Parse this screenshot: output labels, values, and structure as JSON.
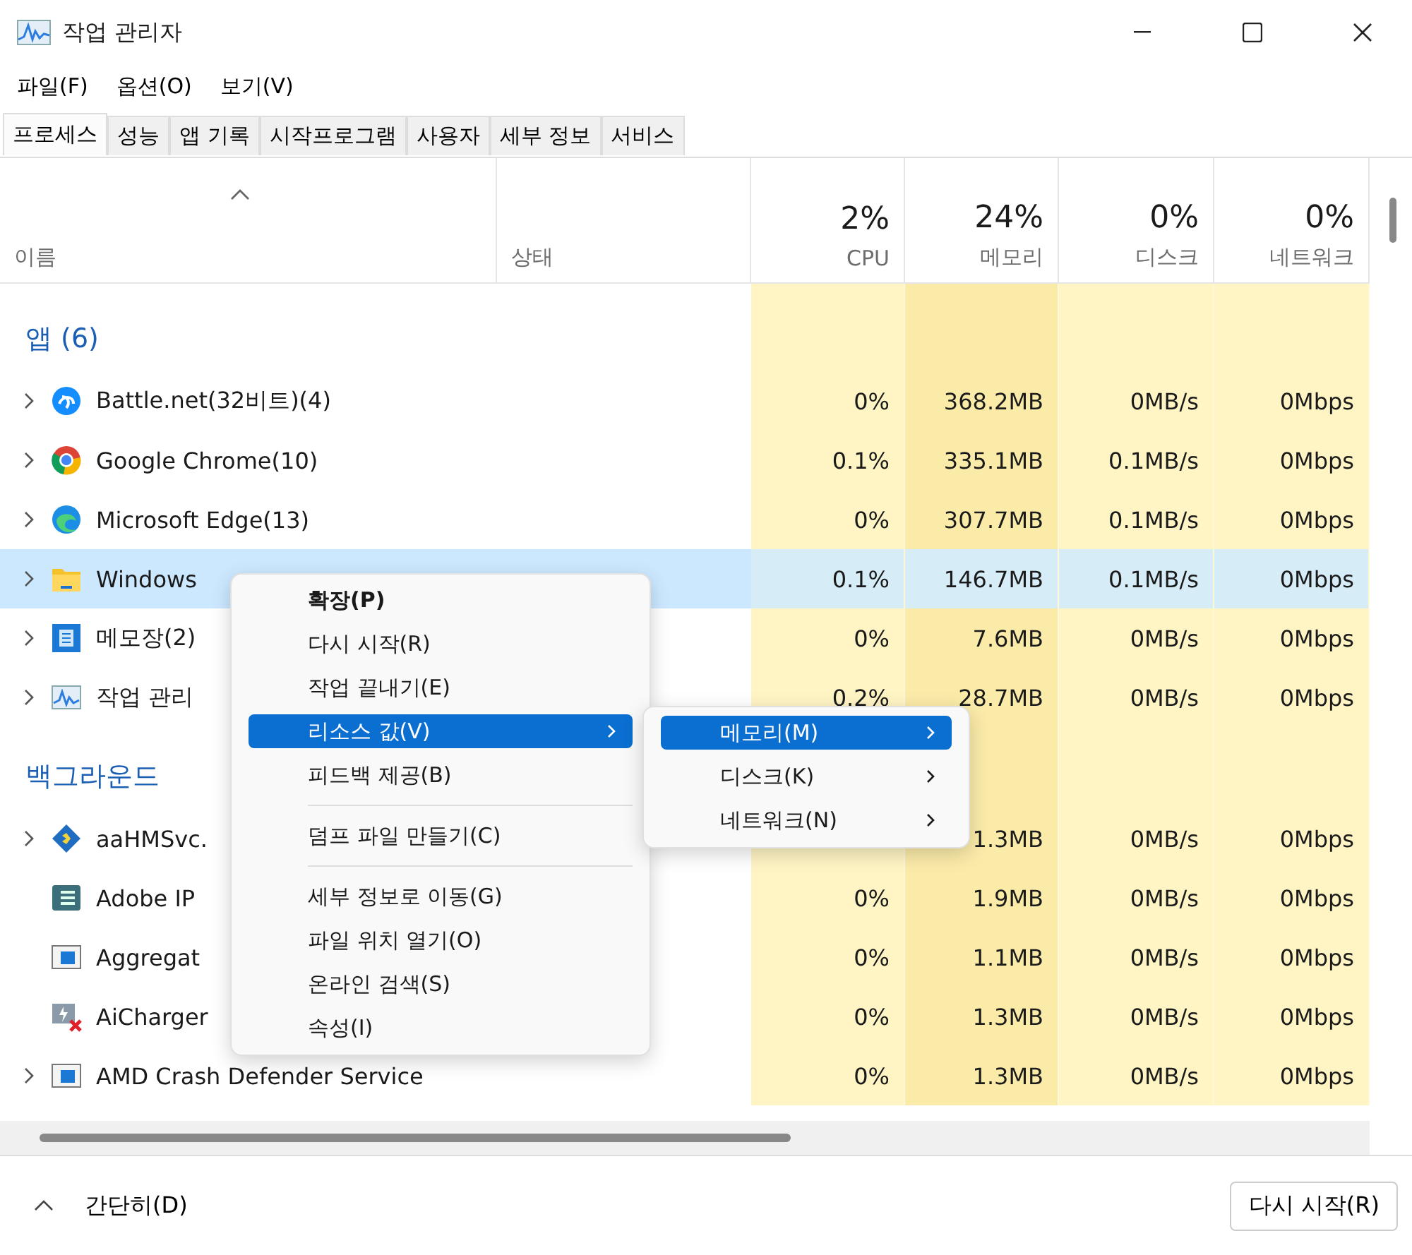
{
  "window": {
    "title": "작업 관리자"
  },
  "menu_bar": [
    "파일(F)",
    "옵션(O)",
    "보기(V)"
  ],
  "tabs": [
    {
      "label": "프로세스",
      "selected": true
    },
    {
      "label": "성능",
      "selected": false
    },
    {
      "label": "앱 기록",
      "selected": false
    },
    {
      "label": "시작프로그램",
      "selected": false
    },
    {
      "label": "사용자",
      "selected": false
    },
    {
      "label": "세부 정보",
      "selected": false
    },
    {
      "label": "서비스",
      "selected": false
    }
  ],
  "columns": [
    {
      "label": "이름",
      "sorted": true
    },
    {
      "label": "상태",
      "sorted": false
    },
    {
      "percent": "2%",
      "label": "CPU"
    },
    {
      "percent": "24%",
      "label": "메모리"
    },
    {
      "percent": "0%",
      "label": "디스크"
    },
    {
      "percent": "0%",
      "label": "네트워크"
    }
  ],
  "groups": [
    {
      "title": "앱 (6)",
      "rows": [
        {
          "name": "Battle.net(32비트)(4)",
          "kind": "swirl",
          "expandable": true,
          "selected": false,
          "cpu": "0%",
          "memory": "368.2MB",
          "disk": "0MB/s",
          "network": "0Mbps"
        },
        {
          "name": "Google Chrome(10)",
          "kind": "ring",
          "expandable": true,
          "selected": false,
          "cpu": "0.1%",
          "memory": "335.1MB",
          "disk": "0.1MB/s",
          "network": "0Mbps"
        },
        {
          "name": "Microsoft Edge(13)",
          "kind": "wave",
          "expandable": true,
          "selected": false,
          "cpu": "0%",
          "memory": "307.7MB",
          "disk": "0.1MB/s",
          "network": "0Mbps"
        },
        {
          "name": "Windows",
          "kind": "folder",
          "expandable": true,
          "selected": true,
          "cpu": "0.1%",
          "memory": "146.7MB",
          "disk": "0.1MB/s",
          "network": "0Mbps"
        },
        {
          "name": "메모장(2)",
          "kind": "notepad",
          "expandable": true,
          "selected": false,
          "cpu": "0%",
          "memory": "7.6MB",
          "disk": "0MB/s",
          "network": "0Mbps"
        },
        {
          "name": "작업 관리",
          "kind": "chart",
          "expandable": true,
          "selected": false,
          "cpu": "0.2%",
          "memory": "28.7MB",
          "disk": "0MB/s",
          "network": "0Mbps"
        }
      ]
    },
    {
      "title": "백그라운드",
      "rows": [
        {
          "name": "aaHMSvc.",
          "kind": "diamond",
          "expandable": true,
          "selected": false,
          "memory": "1.3MB",
          "disk": "0MB/s",
          "network": "0Mbps"
        },
        {
          "name": "Adobe IP",
          "kind": "stack",
          "expandable": false,
          "selected": false,
          "cpu": "0%",
          "memory": "1.9MB",
          "disk": "0MB/s",
          "network": "0Mbps"
        },
        {
          "name": "Aggregat",
          "kind": "window",
          "expandable": false,
          "selected": false,
          "cpu": "0%",
          "memory": "1.1MB",
          "disk": "0MB/s",
          "network": "0Mbps"
        },
        {
          "name": "AiCharger",
          "kind": "plug",
          "expandable": false,
          "selected": false,
          "cpu": "0%",
          "memory": "1.3MB",
          "disk": "0MB/s",
          "network": "0Mbps"
        },
        {
          "name": "AMD Crash Defender Service",
          "kind": "window",
          "expandable": true,
          "selected": false,
          "cpu": "0%",
          "memory": "1.3MB",
          "disk": "0MB/s",
          "network": "0Mbps"
        }
      ]
    }
  ],
  "context_menu": [
    {
      "kind": "item",
      "label": "확장(P)",
      "bold": true,
      "selected": false,
      "submenu": false
    },
    {
      "kind": "item",
      "label": "다시 시작(R)",
      "bold": false,
      "selected": false,
      "submenu": false
    },
    {
      "kind": "item",
      "label": "작업 끝내기(E)",
      "bold": false,
      "selected": false,
      "submenu": false
    },
    {
      "kind": "item",
      "label": "리소스 값(V)",
      "bold": false,
      "selected": true,
      "submenu": true
    },
    {
      "kind": "item",
      "label": "피드백 제공(B)",
      "bold": false,
      "selected": false,
      "submenu": false
    },
    {
      "kind": "separator"
    },
    {
      "kind": "item",
      "label": "덤프 파일 만들기(C)",
      "bold": false,
      "selected": false,
      "submenu": false
    },
    {
      "kind": "separator"
    },
    {
      "kind": "item",
      "label": "세부 정보로 이동(G)",
      "bold": false,
      "selected": false,
      "submenu": false
    },
    {
      "kind": "item",
      "label": "파일 위치 열기(O)",
      "bold": false,
      "selected": false,
      "submenu": false
    },
    {
      "kind": "item",
      "label": "온라인 검색(S)",
      "bold": false,
      "selected": false,
      "submenu": false
    },
    {
      "kind": "item",
      "label": "속성(I)",
      "bold": false,
      "selected": false,
      "submenu": false
    }
  ],
  "submenu": [
    {
      "label": "메모리(M)",
      "selected": true,
      "submenu": true
    },
    {
      "label": "디스크(K)",
      "selected": false,
      "submenu": true
    },
    {
      "label": "네트워크(N)",
      "selected": false,
      "submenu": true
    }
  ],
  "footer": {
    "toggle": "간단히(D)",
    "button": "다시 시작(R)"
  }
}
